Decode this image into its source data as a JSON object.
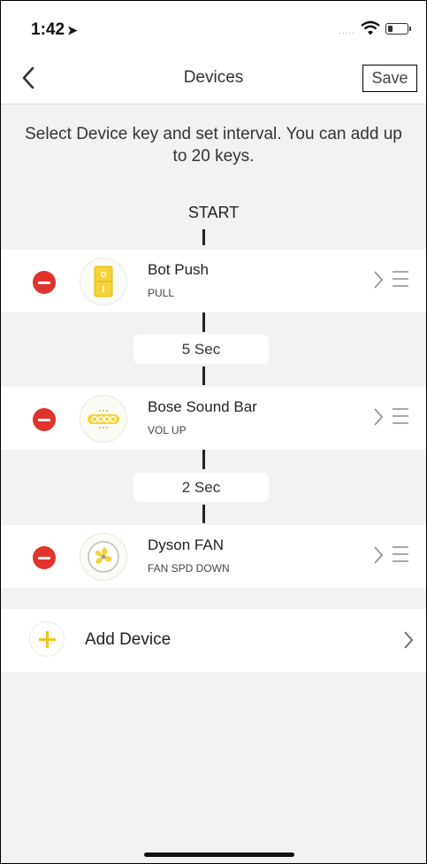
{
  "status_bar": {
    "time": "1:42",
    "signal": "....."
  },
  "nav": {
    "title": "Devices",
    "save_label": "Save"
  },
  "instructions": "Select Device key and set interval. You can add up to 20 keys.",
  "start_label": "START",
  "devices": [
    {
      "name": "Bot Push",
      "action": "PULL",
      "icon": "bot-push-icon"
    },
    {
      "name": "Bose Sound Bar",
      "action": "VOL UP",
      "icon": "sound-bar-icon"
    },
    {
      "name": "Dyson FAN",
      "action": "FAN SPD DOWN",
      "icon": "fan-icon"
    }
  ],
  "intervals": [
    "5 Sec",
    "2 Sec"
  ],
  "add_device": {
    "label": "Add Device",
    "icon": "plus-icon"
  },
  "colors": {
    "remove": "#e0332b",
    "accent": "#f5c518"
  }
}
